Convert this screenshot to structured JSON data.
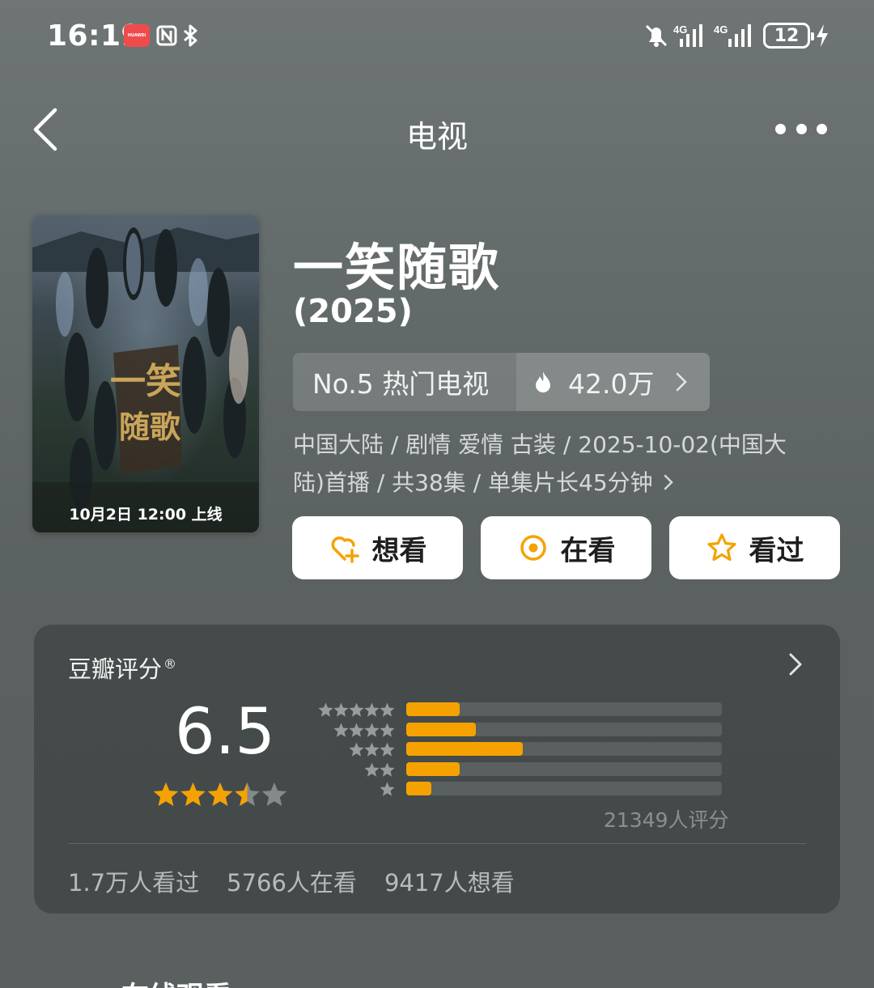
{
  "status_bar": {
    "time": "16:19",
    "badge": "HUAWEI",
    "battery": "12",
    "icons": [
      "huawei-app-icon",
      "nfc-icon",
      "bluetooth-icon",
      "mute-icon",
      "signal-4g-icon",
      "signal-4g-icon",
      "battery-icon",
      "charging-icon"
    ]
  },
  "nav": {
    "title": "电视",
    "back_icon": "chevron-left-icon",
    "more_icon": "more-horizontal-icon"
  },
  "poster": {
    "date_text": "10月2日 12:00 上线"
  },
  "show": {
    "title": "一笑随歌",
    "year": "(2025)",
    "rank_label": "No.5 热门电视",
    "heat_value": "42.0万",
    "meta_line1": "中国大陆 / 剧情 爱情 古装 / 2025-10-02(中国大",
    "meta_line2": "陆)首播 / 共38集 / 单集片长45分钟"
  },
  "actions": {
    "want": "想看",
    "watching": "在看",
    "watched": "看过"
  },
  "rating": {
    "heading": "豆瓣评分",
    "reg_mark": "®",
    "score": "6.5",
    "stars_value": 3.5,
    "stars_max": 5,
    "distribution": [
      {
        "stars": 5,
        "fraction": 0.17
      },
      {
        "stars": 4,
        "fraction": 0.22
      },
      {
        "stars": 3,
        "fraction": 0.37
      },
      {
        "stars": 2,
        "fraction": 0.17
      },
      {
        "stars": 1,
        "fraction": 0.08
      }
    ],
    "count_text": "21349人评分",
    "stats": {
      "watched": "1.7万人看过",
      "watching": "5766人在看",
      "want": "9417人想看"
    }
  },
  "next_section": {
    "heading": "在线观看"
  },
  "colors": {
    "accent": "#f5a200",
    "background": "#636a6a",
    "card": "#3a4141"
  }
}
